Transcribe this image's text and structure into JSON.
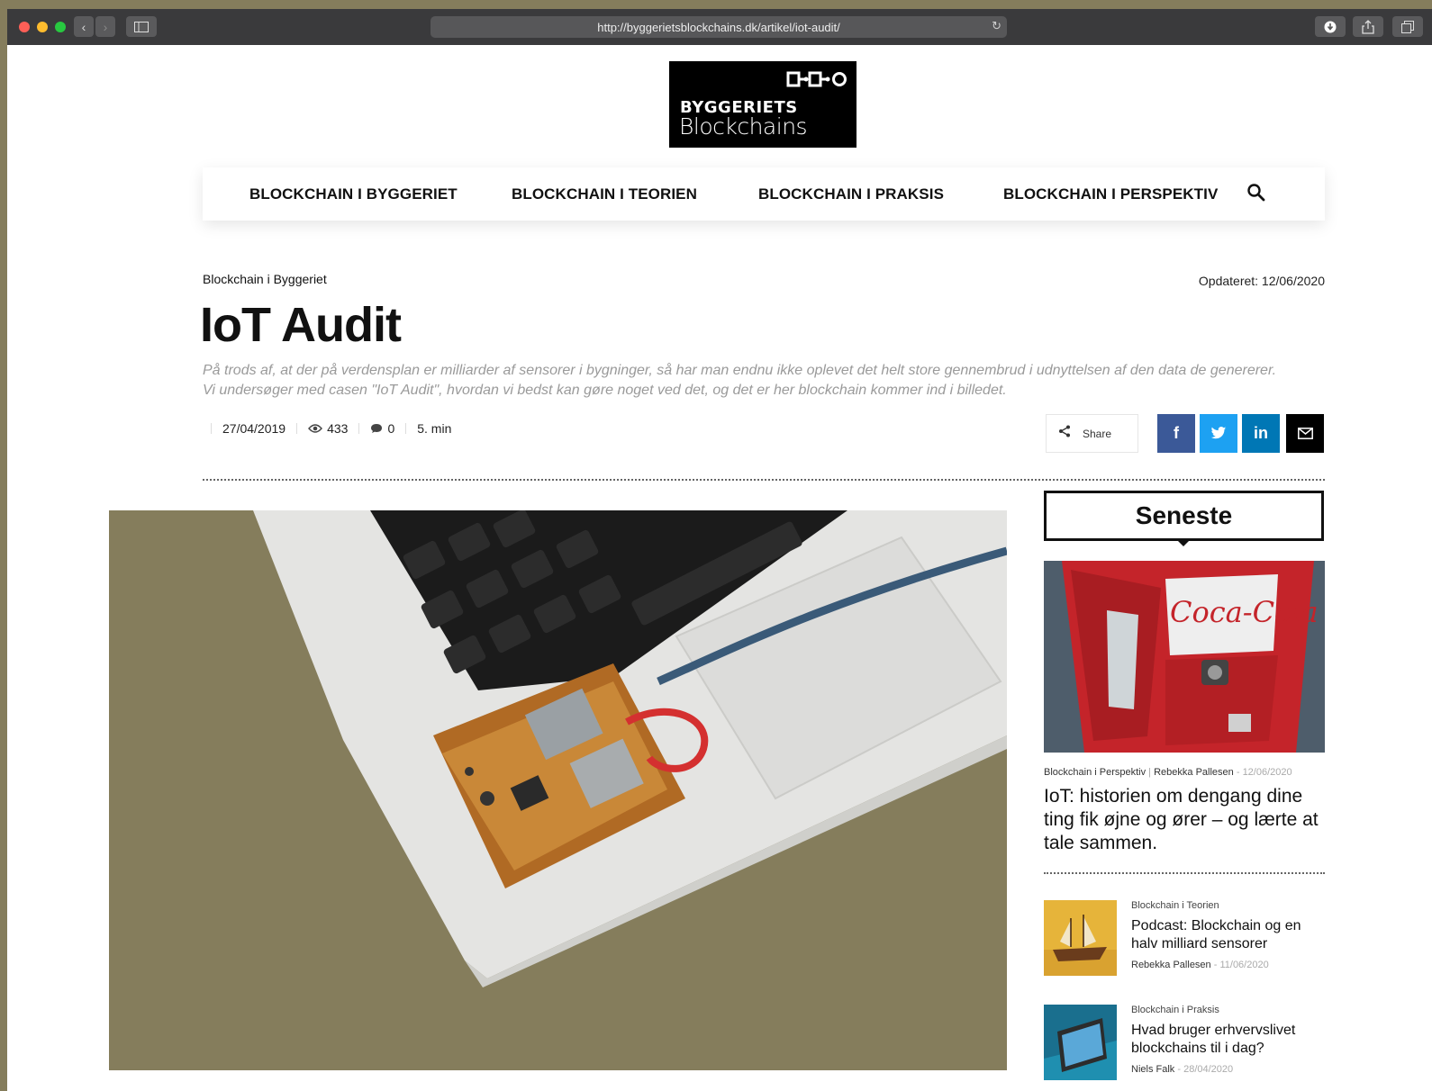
{
  "browser": {
    "url": "http://byggerietsblockchains.dk/artikel/iot-audit/"
  },
  "logo": {
    "line1": "BYGGERIETS",
    "line2": "Blockchains"
  },
  "nav": {
    "items": [
      {
        "label": "BLOCKCHAIN I BYGGERIET"
      },
      {
        "label": "BLOCKCHAIN I TEORIEN"
      },
      {
        "label": "BLOCKCHAIN I PRAKSIS"
      },
      {
        "label": "BLOCKCHAIN I PERSPEKTIV"
      }
    ]
  },
  "article": {
    "category": "Blockchain i Byggeriet",
    "updated": "Opdateret: 12/06/2020",
    "title": "IoT Audit",
    "intro": "På trods af, at der på verdensplan er milliarder af sensorer i bygninger, så har man endnu ikke oplevet det helt store gennembrud i udnyttelsen af den data de genererer. Vi undersøger med casen \"IoT Audit\", hvordan vi bedst kan gøre noget ved det, og det er her blockchain kommer ind i billedet.",
    "date": "27/04/2019",
    "views": "433",
    "comments": "0",
    "read_time": "5. min",
    "share_label": "Share"
  },
  "sidebar": {
    "heading": "Seneste",
    "featured": {
      "category": "Blockchain i Perspektiv",
      "author": "Rebekka Pallesen",
      "date": "12/06/2020",
      "title": "IoT: historien om dengang dine ting fik øjne og ører – og lærte at tale sammen."
    },
    "items": [
      {
        "category": "Blockchain i Teorien",
        "title": "Podcast: Blockchain og en halv milliard sensorer",
        "author": "Rebekka Pallesen",
        "date": "11/06/2020"
      },
      {
        "category": "Blockchain i Praksis",
        "title": "Hvad bruger erhvervslivet blockchains til i dag?",
        "author": "Niels Falk",
        "date": "28/04/2020"
      }
    ]
  },
  "colors": {
    "facebook": "#3b5998",
    "twitter": "#1da1f2",
    "linkedin": "#0077b5",
    "email": "#000000",
    "hero_bg": "#857d5c"
  }
}
